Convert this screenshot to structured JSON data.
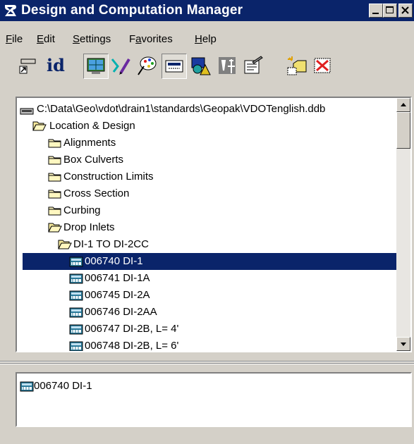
{
  "window": {
    "title": "Design and Computation Manager",
    "title_bar_color": "#0a246a",
    "icon": "design-computation-app-icon",
    "controls": [
      "minimize-icon",
      "maximize-icon",
      "close-icon"
    ]
  },
  "menubar": {
    "items": [
      {
        "label": "File",
        "mnemonic": "F"
      },
      {
        "label": "Edit",
        "mnemonic": "E"
      },
      {
        "label": "Settings",
        "mnemonic": "S"
      },
      {
        "label": "Favorites",
        "mnemonic": "a"
      },
      {
        "label": "Help",
        "mnemonic": "H"
      }
    ]
  },
  "toolbar": {
    "id_label": "id",
    "buttons": [
      "place-cell-icon",
      "identify-icon",
      "display-icon",
      "draw-icon",
      "palette-icon",
      "keyin-icon",
      "shapes-icon",
      "computation-icon",
      "measure-icon",
      "properties-icon",
      "new-item-icon",
      "delete-icon"
    ],
    "pressed": [
      "display-icon",
      "keyin-icon"
    ]
  },
  "tree": {
    "root": "C:\\Data\\Geo\\vdot\\drain1\\standards\\Geopak\\VDOTenglish.ddb",
    "items": [
      {
        "label": "Location & Design",
        "icon": "folder-open-icon",
        "level": 1
      },
      {
        "label": "Alignments",
        "icon": "folder-closed-icon",
        "level": 2
      },
      {
        "label": "Box Culverts",
        "icon": "folder-closed-icon",
        "level": 2
      },
      {
        "label": "Construction Limits",
        "icon": "folder-closed-icon",
        "level": 2
      },
      {
        "label": "Cross Section",
        "icon": "folder-closed-icon",
        "level": 2
      },
      {
        "label": "Curbing",
        "icon": "folder-closed-icon",
        "level": 2
      },
      {
        "label": "Drop Inlets",
        "icon": "folder-open-icon",
        "level": 2
      },
      {
        "label": "DI-1 TO DI-2CC",
        "icon": "folder-open-icon",
        "level": 3
      },
      {
        "label": "006740 DI-1",
        "icon": "item-icon",
        "level": 4,
        "selected": true
      },
      {
        "label": "006741 DI-1A",
        "icon": "item-icon",
        "level": 4
      },
      {
        "label": "006745 DI-2A",
        "icon": "item-icon",
        "level": 4
      },
      {
        "label": "006746 DI-2AA",
        "icon": "item-icon",
        "level": 4
      },
      {
        "label": "006747 DI-2B, L= 4'",
        "icon": "item-icon",
        "level": 4
      },
      {
        "label": "006748 DI-2B, L= 6'",
        "icon": "item-icon",
        "level": 4
      }
    ],
    "selection_color": "#0a246a"
  },
  "detail": {
    "item": "006740 DI-1",
    "icon": "item-icon"
  }
}
